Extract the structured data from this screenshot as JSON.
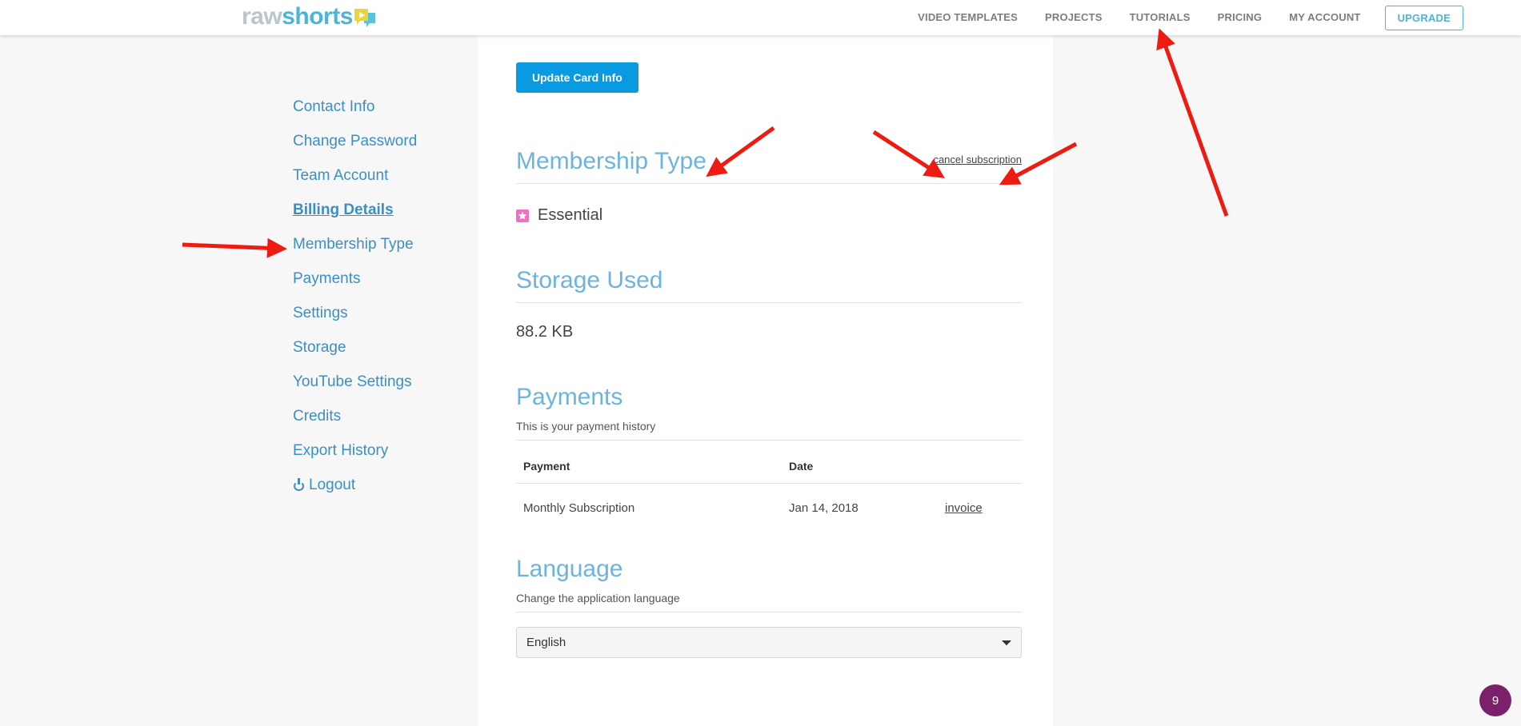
{
  "header": {
    "logo": {
      "part1": "raw",
      "part2": "shorts",
      "mark_icon": "speech-bubble-play-icon"
    },
    "nav": [
      {
        "label": "VIDEO TEMPLATES"
      },
      {
        "label": "PROJECTS"
      },
      {
        "label": "TUTORIALS"
      },
      {
        "label": "PRICING"
      },
      {
        "label": "MY ACCOUNT"
      }
    ],
    "upgrade_label": "UPGRADE"
  },
  "sidebar": {
    "items": [
      {
        "label": "Contact Info",
        "active": false
      },
      {
        "label": "Change Password",
        "active": false
      },
      {
        "label": "Team Account",
        "active": false
      },
      {
        "label": "Billing Details",
        "active": true
      },
      {
        "label": "Membership Type",
        "active": false
      },
      {
        "label": "Payments",
        "active": false
      },
      {
        "label": "Settings",
        "active": false
      },
      {
        "label": "Storage",
        "active": false
      },
      {
        "label": "YouTube Settings",
        "active": false
      },
      {
        "label": "Credits",
        "active": false
      },
      {
        "label": "Export History",
        "active": false
      }
    ],
    "logout_label": "Logout",
    "logout_icon": "power-icon"
  },
  "main": {
    "update_card_label": "Update Card Info",
    "membership": {
      "heading": "Membership Type",
      "cancel_label": "cancel subscription",
      "plan_name": "Essential",
      "plan_badge_icon": "star-icon"
    },
    "storage": {
      "heading": "Storage Used",
      "value": "88.2 KB"
    },
    "payments": {
      "heading": "Payments",
      "subtitle": "This is your payment history",
      "columns": {
        "payment": "Payment",
        "date": "Date",
        "invoice": ""
      },
      "rows": [
        {
          "payment": "Monthly Subscription",
          "date": "Jan 14, 2018",
          "invoice": "invoice"
        }
      ]
    },
    "language": {
      "heading": "Language",
      "subtitle": "Change the application language",
      "selected": "English",
      "options": [
        "English"
      ]
    }
  },
  "corner_badge": {
    "count": "9"
  },
  "colors": {
    "accent_blue": "#4cb3d9",
    "link_blue": "#3b8fc4",
    "heading_blue": "#6cb4dd",
    "button_blue": "#0a9ae1",
    "plan_pink": "#f06ec4",
    "badge_purple": "#7b2069",
    "annotation_red": "#ee1b11",
    "page_bg": "#f7f7f7"
  }
}
